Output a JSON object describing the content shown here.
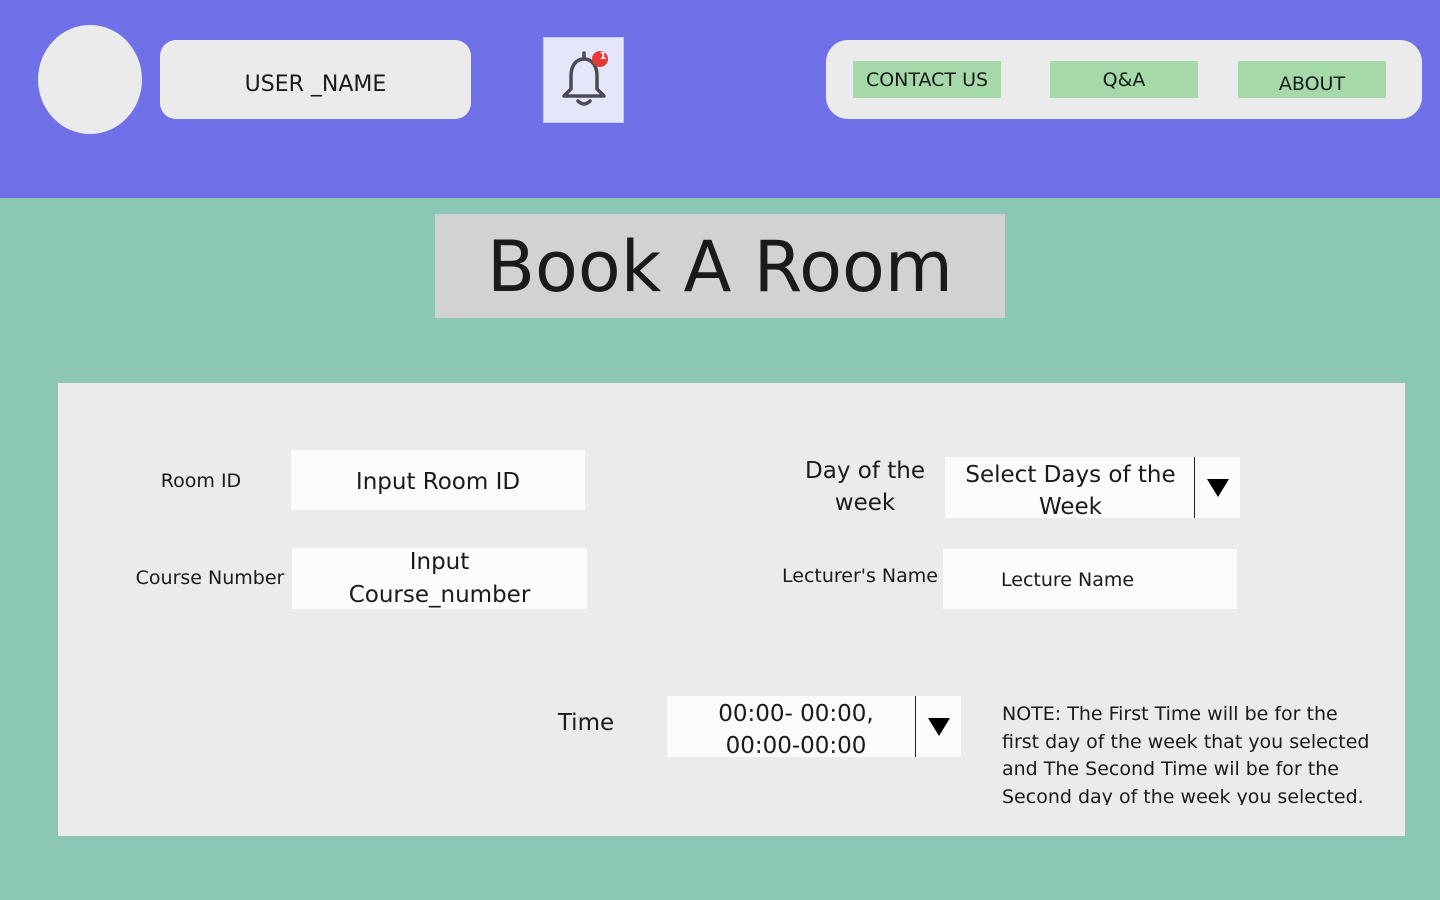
{
  "header": {
    "username": "USER _NAME",
    "notification_count": "1",
    "nav": {
      "contact": "CONTACT US",
      "qa": "Q&A",
      "about": "ABOUT"
    }
  },
  "page_title": "Book A Room",
  "form": {
    "room_id": {
      "label": "Room ID",
      "value": "Input Room ID"
    },
    "course_number": {
      "label": "Course Number",
      "value": "Input Course_number"
    },
    "day_of_week": {
      "label": "Day of the week",
      "value": "Select Days of the Week"
    },
    "lecturer": {
      "label": "Lecturer's Name",
      "value": "Lecture Name"
    },
    "time": {
      "label": "Time",
      "value": "00:00- 00:00, 00:00-00:00"
    },
    "note": "NOTE: The First Time will be for the first day of the week that you selected and The Second Time wil be for the Second day of the week you selected."
  },
  "colors": {
    "header_bg": "#7071e8",
    "page_bg": "#8bc7b4",
    "nav_button_bg": "#a5d9a9",
    "badge": "#e53935"
  },
  "icons": {
    "avatar": "avatar-placeholder",
    "bell": "bell-icon",
    "dropdown": "triangle-down-icon"
  }
}
